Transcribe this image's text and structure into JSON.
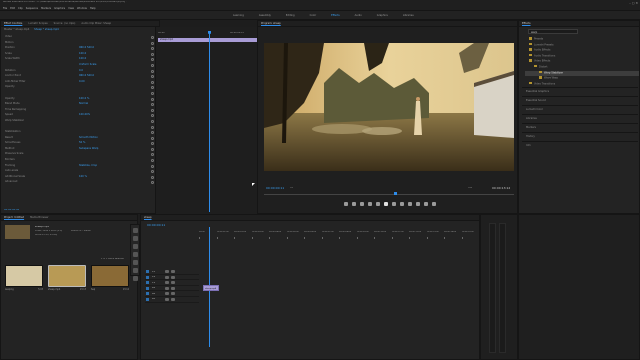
{
  "app": {
    "title": "Adobe Premiere Pro 2020 - C:\\Users\\Brenden\\Documents\\Adobe\\Premiere Pro\\14.0\\Untitled.prproj *",
    "menu": [
      "File",
      "Edit",
      "Clip",
      "Sequence",
      "Markers",
      "Graphics",
      "View",
      "Window",
      "Help"
    ],
    "workspaces": [
      "Learning",
      "Assembly",
      "Editing",
      "Color",
      "Effects",
      "Audio",
      "Graphics",
      "Libraries"
    ],
    "active_workspace": "Effects"
  },
  "effect_controls": {
    "tabs": [
      "Effect Controls",
      "Lumetri Scopes",
      "Source: (no clips)",
      "Audio Clip Mixer: Sheep"
    ],
    "active_tab": "Effect Controls",
    "source_label": "Master * sheep.mp4",
    "clip_label": "Sheep * sheep.mp4",
    "timecode_start": "00:00",
    "timecode_end": "00:00:04:23",
    "clip_bar_label": "sheep.mp4",
    "rows": [
      {
        "label": "Video",
        "value": ""
      },
      {
        "label": "Motion",
        "value": ""
      },
      {
        "label": "Position",
        "value": "960.0   540.0"
      },
      {
        "label": "Scale",
        "value": "100.0"
      },
      {
        "label": "Scale Width",
        "value": "100.0"
      },
      {
        "label": "",
        "value": "Uniform Scale"
      },
      {
        "label": "Rotation",
        "value": "0.0"
      },
      {
        "label": "Anchor Point",
        "value": "960.0   540.0"
      },
      {
        "label": "Anti-flicker Filter",
        "value": "0.00"
      },
      {
        "label": "Opacity",
        "value": ""
      },
      {
        "label": "",
        "value": ""
      },
      {
        "label": "Opacity",
        "value": "100.0 %"
      },
      {
        "label": "Blend Mode",
        "value": "Normal"
      },
      {
        "label": "Time Remapping",
        "value": ""
      },
      {
        "label": "Speed",
        "value": "100.00%"
      },
      {
        "label": "Warp Stabilizer",
        "value": ""
      },
      {
        "label": "",
        "value": ""
      },
      {
        "label": "Stabilization",
        "value": ""
      },
      {
        "label": "Result",
        "value": "Smooth Motion"
      },
      {
        "label": "Smoothness",
        "value": "50 %"
      },
      {
        "label": "Method",
        "value": "Subspace Warp"
      },
      {
        "label": "Preserve Scale",
        "value": ""
      },
      {
        "label": "Borders",
        "value": ""
      },
      {
        "label": "Framing",
        "value": "Stabilize, Crop"
      },
      {
        "label": "Auto-scale",
        "value": ""
      },
      {
        "label": "Additional Scale",
        "value": "100 %"
      },
      {
        "label": "Advanced",
        "value": ""
      }
    ],
    "footer_timecode": "00:00:00:00"
  },
  "program": {
    "title": "Program: sheep",
    "timecode_current": "00:00:00:11",
    "fit": "Fit",
    "quality": "Full",
    "timecode_duration": "00:00:13:12"
  },
  "effects_panel": {
    "title": "Effects",
    "search_value": "warp",
    "tree": [
      {
        "label": "Presets",
        "level": 0
      },
      {
        "label": "Lumetri Presets",
        "level": 0
      },
      {
        "label": "Audio Effects",
        "level": 0
      },
      {
        "label": "Audio Transitions",
        "level": 0
      },
      {
        "label": "Video Effects",
        "level": 0
      },
      {
        "label": "Distort",
        "level": 1
      },
      {
        "label": "Warp Stabilizer",
        "level": 2
      },
      {
        "label": "Wave Warp",
        "level": 2
      },
      {
        "label": "Video Transitions",
        "level": 0
      }
    ],
    "sections": [
      "Essential Graphics",
      "Essential Sound",
      "Lumetri Color",
      "Libraries",
      "Markers",
      "History",
      "Info"
    ]
  },
  "project": {
    "tabs": [
      "Project: Untitled",
      "Media Browser"
    ],
    "file_name": "sheep.mp4",
    "file_info_1": "Video, 3840 x 2160 (1.0)",
    "file_info_2": "00:00:13:13, 25.00p",
    "file_info_3": "48000 Hz - Stereo",
    "items_count": "1 of 3 items selected",
    "items": [
      {
        "name": "Leaping",
        "duration": "5:03",
        "color": "#d6c9a5"
      },
      {
        "name": "sheep.mp4",
        "duration": "13:13",
        "color": "#b89a55"
      },
      {
        "name": "Seq",
        "duration": "13:12",
        "color": "#8a6a36"
      }
    ]
  },
  "timeline": {
    "title": "sheep",
    "timecode": "00:00:00:11",
    "ruler_labels": [
      "00:00",
      "00:00:01:00",
      "00:00:02:00",
      "00:00:03:00",
      "00:00:04:00",
      "00:00:05:00",
      "00:00:06:00",
      "00:00:07:00",
      "00:00:08:00",
      "00:00:09:00",
      "00:00:10:00",
      "00:00:11:00",
      "00:00:12:00",
      "00:00:13:00",
      "00:00:14:00",
      "00:00:15:00"
    ],
    "tracks": [
      "V3",
      "V2",
      "V1",
      "A1",
      "A2",
      "A3"
    ],
    "clip_label": "sheep.mp4"
  }
}
